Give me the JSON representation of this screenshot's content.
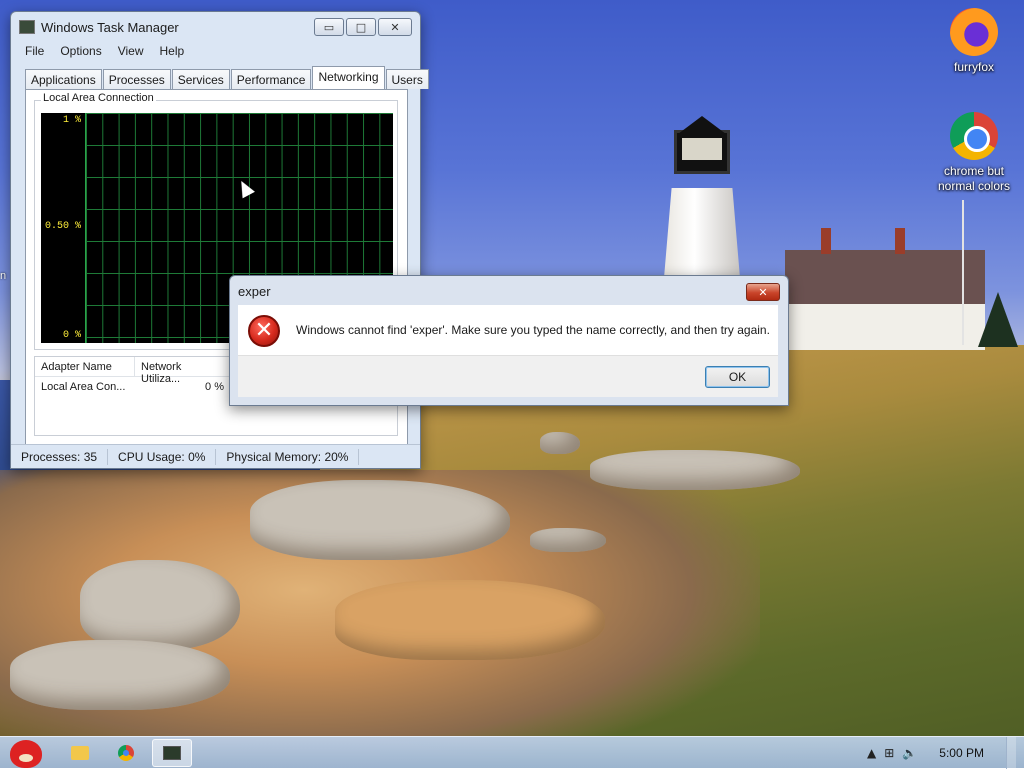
{
  "desktop": {
    "icons": [
      {
        "label": "furryfox",
        "icon": "firefox-icon"
      },
      {
        "label": "chrome but normal colors",
        "icon": "chrome-icon"
      }
    ],
    "edge_fragment": "n"
  },
  "task_manager": {
    "title": "Windows Task Manager",
    "controls": {
      "minimize": "▭",
      "maximize": "□",
      "close": "✕"
    },
    "menu": [
      "File",
      "Options",
      "View",
      "Help"
    ],
    "tabs": [
      "Applications",
      "Processes",
      "Services",
      "Performance",
      "Networking",
      "Users"
    ],
    "active_tab": "Networking",
    "connection_label": "Local Area Connection",
    "graph_axis": [
      "1 %",
      "0.50 %",
      "0 %"
    ],
    "adapter_columns": [
      "Adapter Name",
      "Network Utiliza..."
    ],
    "adapter_rows": [
      {
        "name": "Local Area Con...",
        "utilization": "0 %"
      }
    ],
    "status": {
      "processes": "Processes: 35",
      "cpu": "CPU Usage: 0%",
      "memory": "Physical Memory: 20%"
    }
  },
  "dialog": {
    "title": "exper",
    "close": "✕",
    "icon": "error-icon",
    "message": "Windows cannot find 'exper'. Make sure you typed the name correctly, and then try again.",
    "ok_label": "OK"
  },
  "taskbar": {
    "buttons": [
      "start-orb",
      "explorer",
      "chrome",
      "task-manager"
    ],
    "clock": "5:00 PM",
    "tray_up": "▲",
    "tray_network": "⊞",
    "tray_volume": "🔈"
  }
}
